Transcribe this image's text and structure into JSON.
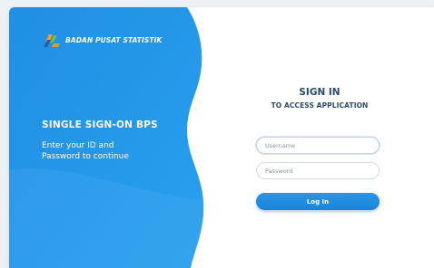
{
  "brand": {
    "name": "BADAN PUSAT STATISTIK",
    "logo_icon": "bps-logo-icon"
  },
  "left_panel": {
    "title": "SINGLE SIGN-ON BPS",
    "description_line1": "Enter your ID and",
    "description_line2": "Password to continue",
    "color": "#1e90e6"
  },
  "form": {
    "title": "SIGN IN",
    "subtitle": "TO ACCESS APPLICATION",
    "username_placeholder": "Username",
    "username_value": "",
    "password_placeholder": "Password",
    "password_value": "",
    "login_label": "Log In",
    "accent_color": "#1a84dc",
    "text_color": "#2b4b6e"
  }
}
